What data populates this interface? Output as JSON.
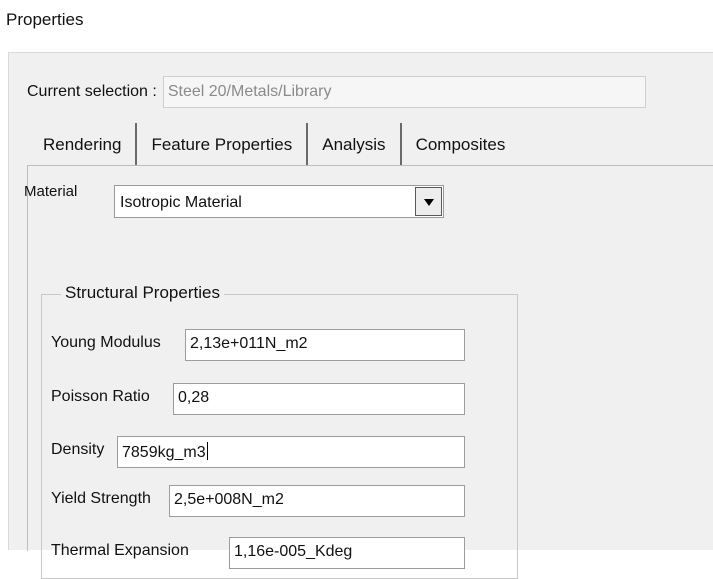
{
  "window": {
    "title": "Properties"
  },
  "current_selection": {
    "label": "Current selection :",
    "value": "Steel 20/Metals/Library"
  },
  "tabs": [
    {
      "label": "Rendering",
      "active": false
    },
    {
      "label": "Feature Properties",
      "active": false
    },
    {
      "label": "Analysis",
      "active": true
    },
    {
      "label": "Composites",
      "active": false
    }
  ],
  "material": {
    "label": "Material",
    "selected": "Isotropic Material"
  },
  "structural": {
    "legend": "Structural Properties",
    "fields": [
      {
        "label": "Young Modulus",
        "value": "2,13e+011N_m2"
      },
      {
        "label": "Poisson Ratio",
        "value": "0,28"
      },
      {
        "label": "Density",
        "value": "7859kg_m3"
      },
      {
        "label": "Yield Strength",
        "value": "2,5e+008N_m2"
      },
      {
        "label": "Thermal Expansion",
        "value": "1,16e-005_Kdeg"
      }
    ]
  },
  "colors": {
    "panel_background": "#f0f0f0",
    "disabled_text": "#8a8a8a"
  }
}
